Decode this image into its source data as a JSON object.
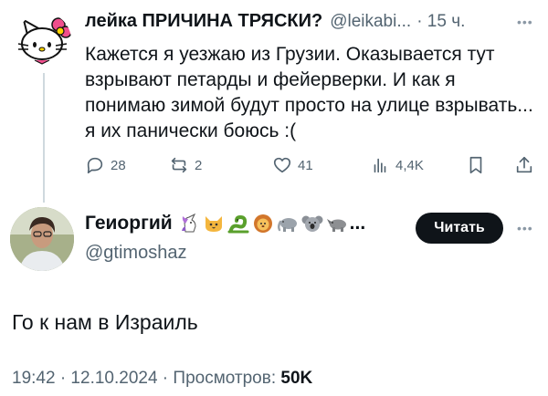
{
  "tweet": {
    "author_name": "лейка ПРИЧИНА ТРЯСКИ?",
    "handle": "@leikabi...",
    "time": "· 15 ч.",
    "text": "Кажется я уезжаю из Грузии. Оказывается тут взрывают петарды и фейерверки. И как я понимаю зимой будут просто на улице взрывать... я их панически боюсь :(",
    "actions": {
      "replies": "28",
      "reposts": "2",
      "likes": "41",
      "views": "4,4K"
    },
    "avatar_icon": "hello-kitty-avatar"
  },
  "reply": {
    "author_name": "Геиоргий",
    "name_emojis": [
      "unicorn",
      "cat",
      "snake",
      "lion",
      "elephant",
      "koala",
      "rhino"
    ],
    "name_ellipsis": "...",
    "handle": "@gtimoshaz",
    "follow_label": "Читать",
    "text": "Го к нам в Израиль",
    "date": "19:42 · 12.10.2024 · Просмотров: ",
    "views": "50K"
  },
  "colors": {
    "text": "#0f1419",
    "secondary": "#536471",
    "thread_line": "#cfd9de",
    "button": "#0f1419"
  }
}
